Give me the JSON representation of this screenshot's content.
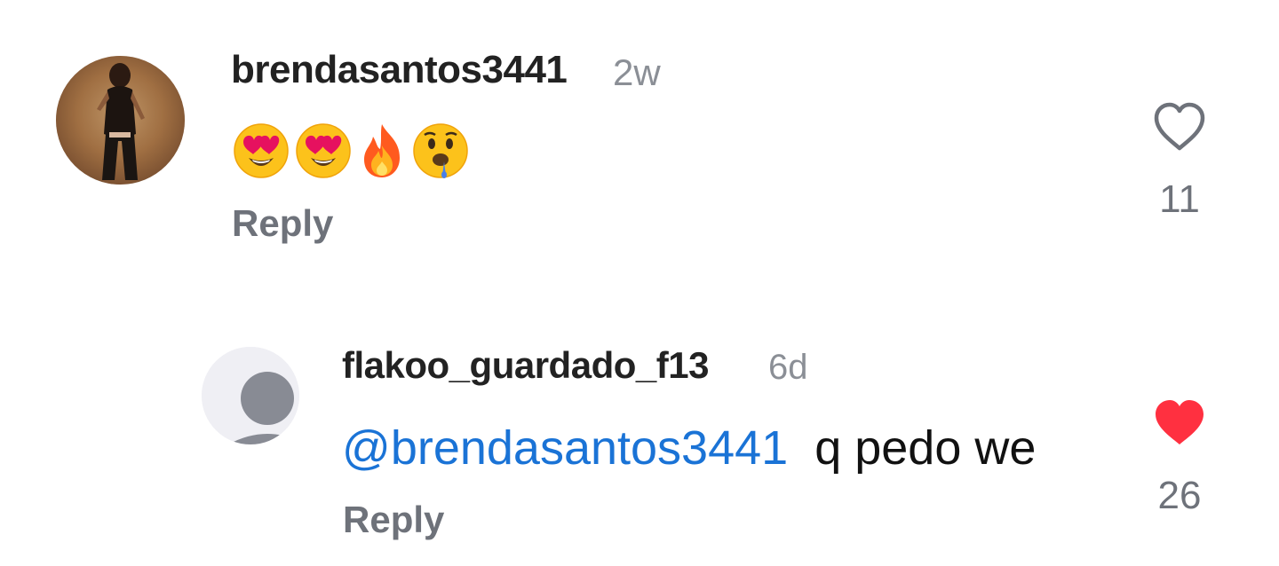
{
  "comments": [
    {
      "username": "brendasantos3441",
      "time": "2w",
      "emojis": [
        "heart-eyes-emoji",
        "heart-eyes-emoji",
        "fire-emoji",
        "drooling-face-emoji"
      ],
      "reply_label": "Reply",
      "like_count": "11",
      "liked": false
    },
    {
      "username": "flakoo_guardado_f13",
      "time": "6d",
      "mention": "@brendasantos3441",
      "text": "q pedo we",
      "reply_label": "Reply",
      "like_count": "26",
      "liked": true
    }
  ],
  "colors": {
    "mention": "#1a73d6",
    "like_active": "#ff3040",
    "muted": "#6e727a"
  }
}
